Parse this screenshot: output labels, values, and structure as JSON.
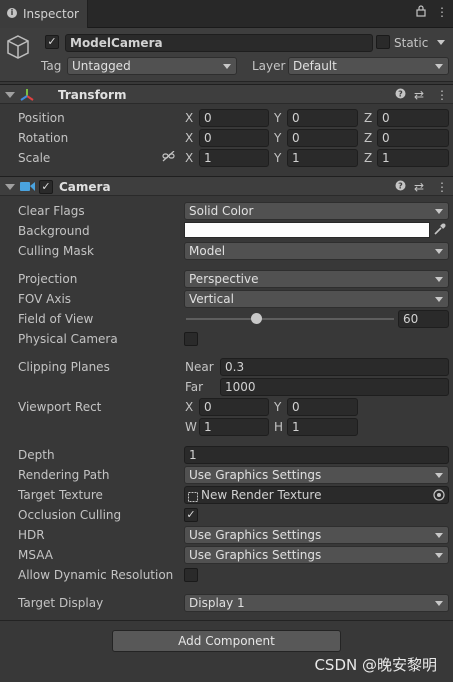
{
  "tab": {
    "label": "Inspector"
  },
  "header": {
    "active": "✓",
    "object_name": "ModelCamera",
    "static_label": "Static",
    "tag_label": "Tag",
    "tag_value": "Untagged",
    "layer_label": "Layer",
    "layer_value": "Default"
  },
  "transform": {
    "title": "Transform",
    "position": {
      "label": "Position",
      "x": "0",
      "y": "0",
      "z": "0"
    },
    "rotation": {
      "label": "Rotation",
      "x": "0",
      "y": "0",
      "z": "0"
    },
    "scale": {
      "label": "Scale",
      "x": "1",
      "y": "1",
      "z": "1"
    },
    "axis": {
      "x": "X",
      "y": "Y",
      "z": "Z"
    }
  },
  "camera": {
    "title": "Camera",
    "enabled": "✓",
    "clear_flags": {
      "label": "Clear Flags",
      "value": "Solid Color"
    },
    "background": {
      "label": "Background",
      "color": "#ffffff"
    },
    "culling_mask": {
      "label": "Culling Mask",
      "value": "Model"
    },
    "projection": {
      "label": "Projection",
      "value": "Perspective"
    },
    "fov_axis": {
      "label": "FOV Axis",
      "value": "Vertical"
    },
    "field_of_view": {
      "label": "Field of View",
      "value": "60",
      "slider_fraction": 0.33
    },
    "physical_camera": {
      "label": "Physical Camera",
      "checked": false
    },
    "clipping_planes": {
      "label": "Clipping Planes",
      "near_label": "Near",
      "near": "0.3",
      "far_label": "Far",
      "far": "1000"
    },
    "viewport_rect": {
      "label": "Viewport Rect",
      "x": "0",
      "y": "0",
      "w": "1",
      "h": "1",
      "w_label": "W",
      "h_label": "H"
    },
    "depth": {
      "label": "Depth",
      "value": "1"
    },
    "rendering_path": {
      "label": "Rendering Path",
      "value": "Use Graphics Settings"
    },
    "target_texture": {
      "label": "Target Texture",
      "value": "New Render Texture"
    },
    "occlusion_culling": {
      "label": "Occlusion Culling",
      "check": "✓"
    },
    "hdr": {
      "label": "HDR",
      "value": "Use Graphics Settings"
    },
    "msaa": {
      "label": "MSAA",
      "value": "Use Graphics Settings"
    },
    "allow_dynamic_resolution": {
      "label": "Allow Dynamic Resolution",
      "checked": false
    },
    "target_display": {
      "label": "Target Display",
      "value": "Display 1"
    }
  },
  "add_component": "Add Component",
  "watermark": "CSDN @晚安黎明",
  "icons": [
    "info-icon",
    "lock-icon",
    "menu-dots-icon",
    "cube-icon",
    "transform-axes-icon",
    "camera-icon",
    "help-icon",
    "preset-icon",
    "link-icon",
    "eyedropper-icon",
    "render-texture-icon",
    "object-picker-icon"
  ]
}
